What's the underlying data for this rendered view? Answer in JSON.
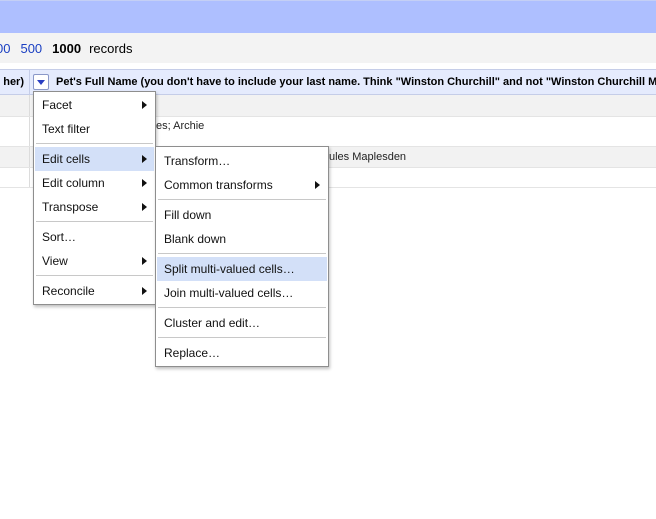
{
  "pager": {
    "pages": [
      "00",
      "500"
    ],
    "current": "1000",
    "records_label": "records"
  },
  "header": {
    "left_column_fragment": "her)",
    "main_column_title": "Pet's Full Name (you don't have to include your last name. Think \"Winston Churchill\" and not \"Winston Churchill M"
  },
  "rows": {
    "row1_text": "es; Archie",
    "row2_text": "ules Maplesden"
  },
  "column_menu": {
    "items": [
      {
        "label": "Facet",
        "has_submenu": true
      },
      {
        "label": "Text filter",
        "has_submenu": false
      },
      {
        "label": "Edit cells",
        "has_submenu": true,
        "active": true
      },
      {
        "label": "Edit column",
        "has_submenu": true
      },
      {
        "label": "Transpose",
        "has_submenu": true
      },
      {
        "label": "Sort…",
        "has_submenu": false
      },
      {
        "label": "View",
        "has_submenu": true
      },
      {
        "label": "Reconcile",
        "has_submenu": true
      }
    ]
  },
  "edit_cells_menu": {
    "items": [
      {
        "label": "Transform…",
        "has_submenu": false
      },
      {
        "label": "Common transforms",
        "has_submenu": true
      },
      {
        "label": "Fill down",
        "has_submenu": false
      },
      {
        "label": "Blank down",
        "has_submenu": false
      },
      {
        "label": "Split multi-valued cells…",
        "has_submenu": false,
        "active": true
      },
      {
        "label": "Join multi-valued cells…",
        "has_submenu": false
      },
      {
        "label": "Cluster and edit…",
        "has_submenu": false
      },
      {
        "label": "Replace…",
        "has_submenu": false
      }
    ]
  },
  "colors": {
    "topbar": "#aebfff",
    "header_bg": "#e5ebfd",
    "link": "#1a3fc2",
    "menu_highlight": "#d3e0f8"
  }
}
